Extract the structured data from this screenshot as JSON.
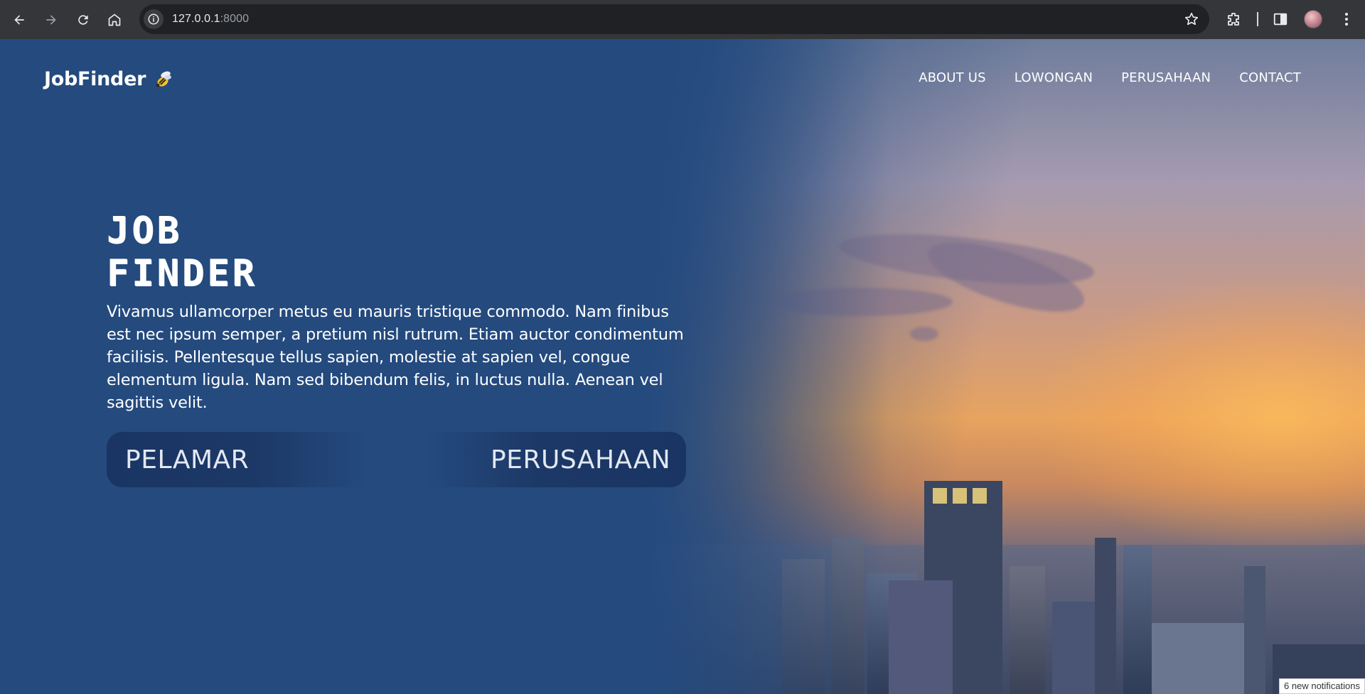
{
  "browser": {
    "url_host": "127.0.0.1",
    "url_port": ":8000"
  },
  "header": {
    "brand": "JobFinder",
    "nav": [
      "ABOUT US",
      "LOWONGAN",
      "PERUSAHAAN",
      "CONTACT"
    ]
  },
  "hero": {
    "title_line1": "JOB",
    "title_line2": "FINDER",
    "description": "Vivamus ullamcorper metus eu mauris tristique commodo. Nam finibus est nec ipsum semper, a pretium nisl rutrum. Etiam auctor condimentum facilisis. Pellentesque tellus sapien, molestie at sapien vel, congue elementum ligula. Nam sed bibendum felis, in luctus nulla. Aenean vel sagittis velit.",
    "button_left": "PELAMAR",
    "button_right": "PERUSAHAAN"
  },
  "system": {
    "notifications": "6 new notifications"
  },
  "colors": {
    "page_bg": "#244a7e",
    "chrome_bg": "#35363a",
    "omnibox_bg": "#202124"
  }
}
